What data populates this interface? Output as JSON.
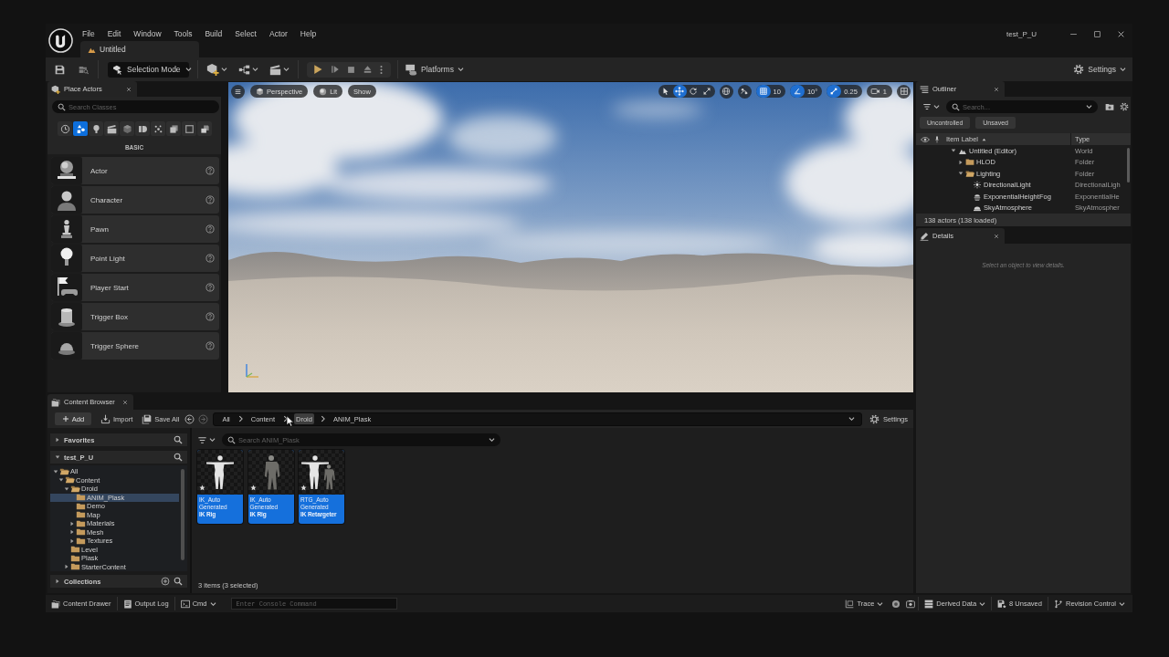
{
  "window": {
    "title": "test_P_U"
  },
  "menu": [
    "File",
    "Edit",
    "Window",
    "Tools",
    "Build",
    "Select",
    "Actor",
    "Help"
  ],
  "document_tab": {
    "label": "Untitled"
  },
  "toolbar": {
    "mode": "Selection Mode",
    "platforms": "Platforms",
    "settings": "Settings"
  },
  "place_actors": {
    "tab": "Place Actors",
    "search": {
      "placeholder": "Search Classes"
    },
    "categories": [
      {
        "selected": false
      },
      {
        "selected": true
      },
      {
        "selected": false
      },
      {
        "selected": false
      },
      {
        "selected": false
      },
      {
        "selected": false
      },
      {
        "selected": false
      },
      {
        "selected": false
      },
      {
        "selected": false
      },
      {
        "selected": false
      }
    ],
    "section": "BASIC",
    "items": [
      {
        "label": "Actor"
      },
      {
        "label": "Character"
      },
      {
        "label": "Pawn"
      },
      {
        "label": "Point Light"
      },
      {
        "label": "Player Start"
      },
      {
        "label": "Trigger Box"
      },
      {
        "label": "Trigger Sphere"
      }
    ]
  },
  "viewport": {
    "view_buttons": [
      "Perspective",
      "Lit",
      "Show"
    ],
    "transform_tools": [
      {
        "selected": false
      },
      {
        "selected": true
      },
      {
        "selected": false
      },
      {
        "selected": false
      }
    ],
    "snaps": [
      {
        "value": "10",
        "on": true
      },
      {
        "value": "10°",
        "on": true
      },
      {
        "value": "0.25",
        "on": true
      }
    ],
    "camera_speed": "1"
  },
  "outliner": {
    "tab": "Outliner",
    "search": {
      "placeholder": "Search..."
    },
    "filters": [
      "Uncontrolled",
      "Unsaved"
    ],
    "columns": [
      "Item Label",
      "Type"
    ],
    "rows": [
      {
        "label": "Untitled (Editor)",
        "type": "World",
        "kind": "world",
        "expanded": true,
        "children": [
          {
            "label": "HLOD",
            "type": "Folder",
            "kind": "folder",
            "expanded": false
          },
          {
            "label": "Lighting",
            "type": "Folder",
            "kind": "folder",
            "expanded": true,
            "children": [
              {
                "label": "DirectionalLight",
                "type": "DirectionalLigh",
                "kind": "light"
              },
              {
                "label": "ExponentialHeightFog",
                "type": "ExponentialHe",
                "kind": "fog"
              },
              {
                "label": "SkyAtmosphere",
                "type": "SkyAtmospher",
                "kind": "sky"
              }
            ]
          }
        ]
      }
    ],
    "status": "138 actors (138 loaded)"
  },
  "details": {
    "tab": "Details",
    "message": "Select an object to view details."
  },
  "content_browser": {
    "tab": "Content Browser",
    "actions": [
      "Add",
      "Import",
      "Save All"
    ],
    "path": [
      {
        "label": "All",
        "highlighted": false
      },
      {
        "label": "Content",
        "highlighted": false
      },
      {
        "label": "Droid",
        "highlighted": true
      },
      {
        "label": "ANIM_Plask",
        "highlighted": false
      }
    ],
    "settings": "Settings",
    "favorites": {
      "label": "Favorites",
      "expanded": false
    },
    "project": {
      "label": "test_P_U",
      "expanded": true,
      "tree": [
        {
          "label": "All",
          "expanded": true,
          "selected": false,
          "children": [
            {
              "label": "Content",
              "expanded": true,
              "selected": false,
              "children": [
                {
                  "label": "Droid",
                  "expanded": true,
                  "selected": false,
                  "children": [
                    {
                      "label": "ANIM_Plask",
                      "selected": true
                    },
                    {
                      "label": "Demo",
                      "selected": false
                    },
                    {
                      "label": "Map",
                      "selected": false
                    },
                    {
                      "label": "Materials",
                      "expanded": false,
                      "selected": false
                    },
                    {
                      "label": "Mesh",
                      "expanded": false,
                      "selected": false
                    },
                    {
                      "label": "Textures",
                      "expanded": false,
                      "selected": false
                    }
                  ]
                },
                {
                  "label": "Level",
                  "selected": false
                },
                {
                  "label": "Plask",
                  "selected": false
                },
                {
                  "label": "StarterContent",
                  "expanded": false,
                  "selected": false
                }
              ]
            }
          ]
        }
      ]
    },
    "collections": {
      "label": "Collections",
      "expanded": false
    },
    "search": {
      "placeholder": "Search ANIM_Plask"
    },
    "assets": [
      {
        "name": "IK_Auto Generated",
        "type": "IK Rig",
        "kind": "mannequin",
        "selected": true
      },
      {
        "name": "IK_Auto Generated",
        "type": "IK Rig",
        "kind": "droid",
        "selected": true
      },
      {
        "name": "RTG_Auto Generated",
        "type": "IK Retargeter",
        "kind": "pair",
        "selected": true
      }
    ],
    "footer": "3 items (3 selected)"
  },
  "status_bar": {
    "left": [
      {
        "label": "Content Drawer",
        "dropdown": false
      },
      {
        "label": "Output Log",
        "dropdown": false
      },
      {
        "label": "Cmd",
        "dropdown": true
      }
    ],
    "console": {
      "placeholder": "Enter Console Command"
    },
    "right": [
      {
        "label": "Trace",
        "dropdown": true
      },
      {
        "label": "Derived Data",
        "dropdown": true
      },
      {
        "label": "8 Unsaved",
        "dropdown": false
      },
      {
        "label": "Revision Control",
        "dropdown": true
      }
    ]
  }
}
